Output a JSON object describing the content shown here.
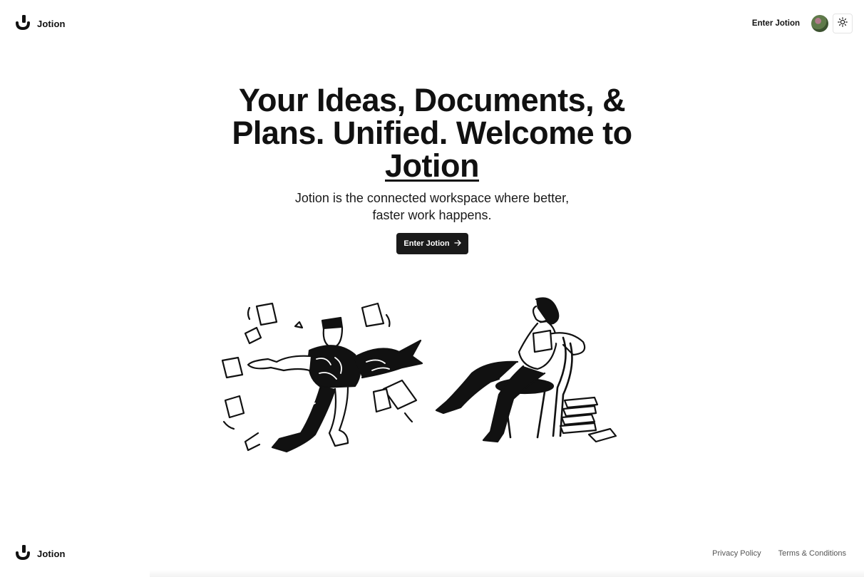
{
  "navbar": {
    "brand_name": "Jotion",
    "enter_link": "Enter Jotion",
    "theme_toggle_icon": "sun-icon"
  },
  "hero": {
    "title_line": "Your Ideas, Documents, & Plans. Unified. Welcome to",
    "title_brand": "Jotion",
    "subtitle": "Jotion is the connected workspace where better, faster work happens.",
    "cta_label": "Enter Jotion",
    "cta_icon": "arrow-right-icon"
  },
  "illustrations": {
    "left": "person-juggling-documents",
    "right": "person-reading-in-chair"
  },
  "footer": {
    "brand_name": "Jotion",
    "links": [
      "Privacy Policy",
      "Terms & Conditions"
    ]
  },
  "colors": {
    "text": "#111111",
    "button_bg": "#1a1a1a",
    "button_text": "#ffffff",
    "footer_link": "#555555"
  }
}
